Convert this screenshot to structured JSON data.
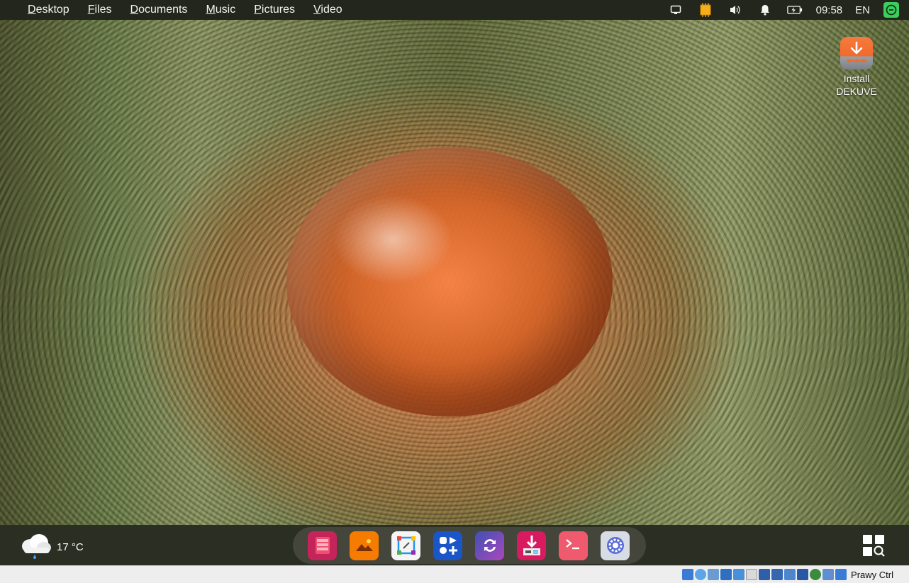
{
  "topbar": {
    "menu": [
      {
        "label": "Desktop"
      },
      {
        "label": "Files"
      },
      {
        "label": "Documents"
      },
      {
        "label": "Music"
      },
      {
        "label": "Pictures"
      },
      {
        "label": "Video"
      }
    ],
    "tray": {
      "clock": "09:58",
      "language": "EN",
      "icons": [
        "screen-icon",
        "cpu-icon",
        "volume-icon",
        "bell-icon",
        "battery-charging-icon",
        "update-manager-icon"
      ]
    }
  },
  "desktop": {
    "icons": [
      {
        "label": "Install DEKUVE",
        "icon": "installer-icon"
      }
    ]
  },
  "bottom_panel": {
    "weather": {
      "temperature": "17 °C",
      "icon": "rain-cloud-icon"
    },
    "dock_apps": [
      {
        "name": "archive-manager",
        "icon": "archive-icon",
        "color": "#c4245a"
      },
      {
        "name": "image-viewer",
        "icon": "image-icon",
        "color": "#f57c00"
      },
      {
        "name": "screenshot-tool",
        "icon": "screenshot-icon",
        "color": "#f5f5f5"
      },
      {
        "name": "app-center",
        "icon": "app-center-icon",
        "color": "#1a56c8"
      },
      {
        "name": "sync-tool",
        "icon": "sync-icon",
        "color": "#6a4fc2"
      },
      {
        "name": "software-installer",
        "icon": "installer-package-icon",
        "color": "#d81b60"
      },
      {
        "name": "terminal",
        "icon": "terminal-icon",
        "color": "#f05a6e"
      },
      {
        "name": "settings",
        "icon": "settings-gear-icon",
        "color": "#d8dce4"
      }
    ],
    "launcher_icon": "app-grid-search-icon"
  },
  "vbox_statusbar": {
    "host_key": "Prawy Ctrl",
    "icons": [
      "hdd-icon",
      "optical-drive-icon",
      "audio-icon",
      "network-icon",
      "usb-icon",
      "shared-folders-icon",
      "display-icon",
      "recording-icon",
      "mouse-integration-icon",
      "cpu-activity-icon",
      "vt-x-icon",
      "guest-additions-icon",
      "download-arrow-icon"
    ]
  }
}
